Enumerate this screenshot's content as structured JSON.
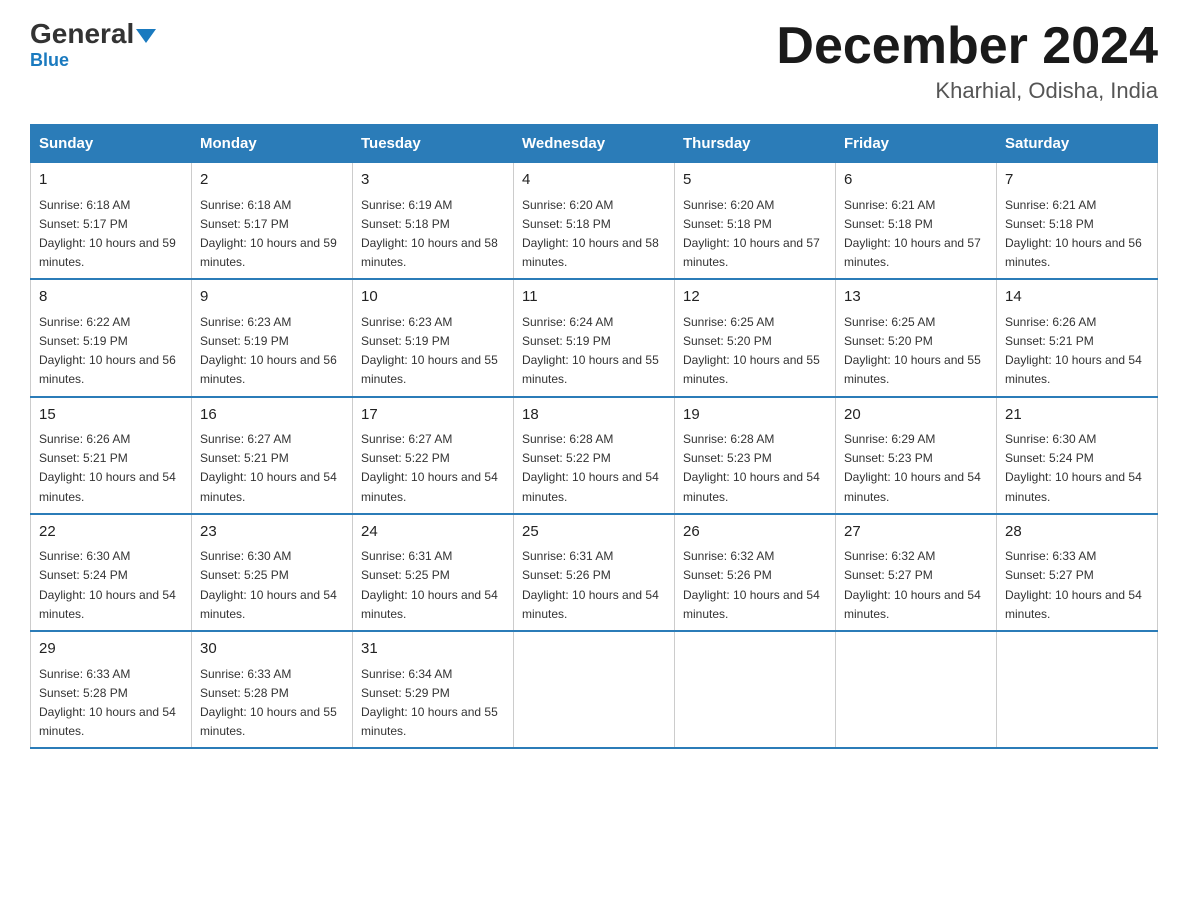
{
  "header": {
    "logo_general": "General",
    "logo_blue": "Blue",
    "month_title": "December 2024",
    "location": "Kharhial, Odisha, India"
  },
  "days_of_week": [
    "Sunday",
    "Monday",
    "Tuesday",
    "Wednesday",
    "Thursday",
    "Friday",
    "Saturday"
  ],
  "weeks": [
    [
      {
        "day": "1",
        "sunrise": "6:18 AM",
        "sunset": "5:17 PM",
        "daylight": "10 hours and 59 minutes"
      },
      {
        "day": "2",
        "sunrise": "6:18 AM",
        "sunset": "5:17 PM",
        "daylight": "10 hours and 59 minutes"
      },
      {
        "day": "3",
        "sunrise": "6:19 AM",
        "sunset": "5:18 PM",
        "daylight": "10 hours and 58 minutes"
      },
      {
        "day": "4",
        "sunrise": "6:20 AM",
        "sunset": "5:18 PM",
        "daylight": "10 hours and 58 minutes"
      },
      {
        "day": "5",
        "sunrise": "6:20 AM",
        "sunset": "5:18 PM",
        "daylight": "10 hours and 57 minutes"
      },
      {
        "day": "6",
        "sunrise": "6:21 AM",
        "sunset": "5:18 PM",
        "daylight": "10 hours and 57 minutes"
      },
      {
        "day": "7",
        "sunrise": "6:21 AM",
        "sunset": "5:18 PM",
        "daylight": "10 hours and 56 minutes"
      }
    ],
    [
      {
        "day": "8",
        "sunrise": "6:22 AM",
        "sunset": "5:19 PM",
        "daylight": "10 hours and 56 minutes"
      },
      {
        "day": "9",
        "sunrise": "6:23 AM",
        "sunset": "5:19 PM",
        "daylight": "10 hours and 56 minutes"
      },
      {
        "day": "10",
        "sunrise": "6:23 AM",
        "sunset": "5:19 PM",
        "daylight": "10 hours and 55 minutes"
      },
      {
        "day": "11",
        "sunrise": "6:24 AM",
        "sunset": "5:19 PM",
        "daylight": "10 hours and 55 minutes"
      },
      {
        "day": "12",
        "sunrise": "6:25 AM",
        "sunset": "5:20 PM",
        "daylight": "10 hours and 55 minutes"
      },
      {
        "day": "13",
        "sunrise": "6:25 AM",
        "sunset": "5:20 PM",
        "daylight": "10 hours and 55 minutes"
      },
      {
        "day": "14",
        "sunrise": "6:26 AM",
        "sunset": "5:21 PM",
        "daylight": "10 hours and 54 minutes"
      }
    ],
    [
      {
        "day": "15",
        "sunrise": "6:26 AM",
        "sunset": "5:21 PM",
        "daylight": "10 hours and 54 minutes"
      },
      {
        "day": "16",
        "sunrise": "6:27 AM",
        "sunset": "5:21 PM",
        "daylight": "10 hours and 54 minutes"
      },
      {
        "day": "17",
        "sunrise": "6:27 AM",
        "sunset": "5:22 PM",
        "daylight": "10 hours and 54 minutes"
      },
      {
        "day": "18",
        "sunrise": "6:28 AM",
        "sunset": "5:22 PM",
        "daylight": "10 hours and 54 minutes"
      },
      {
        "day": "19",
        "sunrise": "6:28 AM",
        "sunset": "5:23 PM",
        "daylight": "10 hours and 54 minutes"
      },
      {
        "day": "20",
        "sunrise": "6:29 AM",
        "sunset": "5:23 PM",
        "daylight": "10 hours and 54 minutes"
      },
      {
        "day": "21",
        "sunrise": "6:30 AM",
        "sunset": "5:24 PM",
        "daylight": "10 hours and 54 minutes"
      }
    ],
    [
      {
        "day": "22",
        "sunrise": "6:30 AM",
        "sunset": "5:24 PM",
        "daylight": "10 hours and 54 minutes"
      },
      {
        "day": "23",
        "sunrise": "6:30 AM",
        "sunset": "5:25 PM",
        "daylight": "10 hours and 54 minutes"
      },
      {
        "day": "24",
        "sunrise": "6:31 AM",
        "sunset": "5:25 PM",
        "daylight": "10 hours and 54 minutes"
      },
      {
        "day": "25",
        "sunrise": "6:31 AM",
        "sunset": "5:26 PM",
        "daylight": "10 hours and 54 minutes"
      },
      {
        "day": "26",
        "sunrise": "6:32 AM",
        "sunset": "5:26 PM",
        "daylight": "10 hours and 54 minutes"
      },
      {
        "day": "27",
        "sunrise": "6:32 AM",
        "sunset": "5:27 PM",
        "daylight": "10 hours and 54 minutes"
      },
      {
        "day": "28",
        "sunrise": "6:33 AM",
        "sunset": "5:27 PM",
        "daylight": "10 hours and 54 minutes"
      }
    ],
    [
      {
        "day": "29",
        "sunrise": "6:33 AM",
        "sunset": "5:28 PM",
        "daylight": "10 hours and 54 minutes"
      },
      {
        "day": "30",
        "sunrise": "6:33 AM",
        "sunset": "5:28 PM",
        "daylight": "10 hours and 55 minutes"
      },
      {
        "day": "31",
        "sunrise": "6:34 AM",
        "sunset": "5:29 PM",
        "daylight": "10 hours and 55 minutes"
      },
      null,
      null,
      null,
      null
    ]
  ]
}
